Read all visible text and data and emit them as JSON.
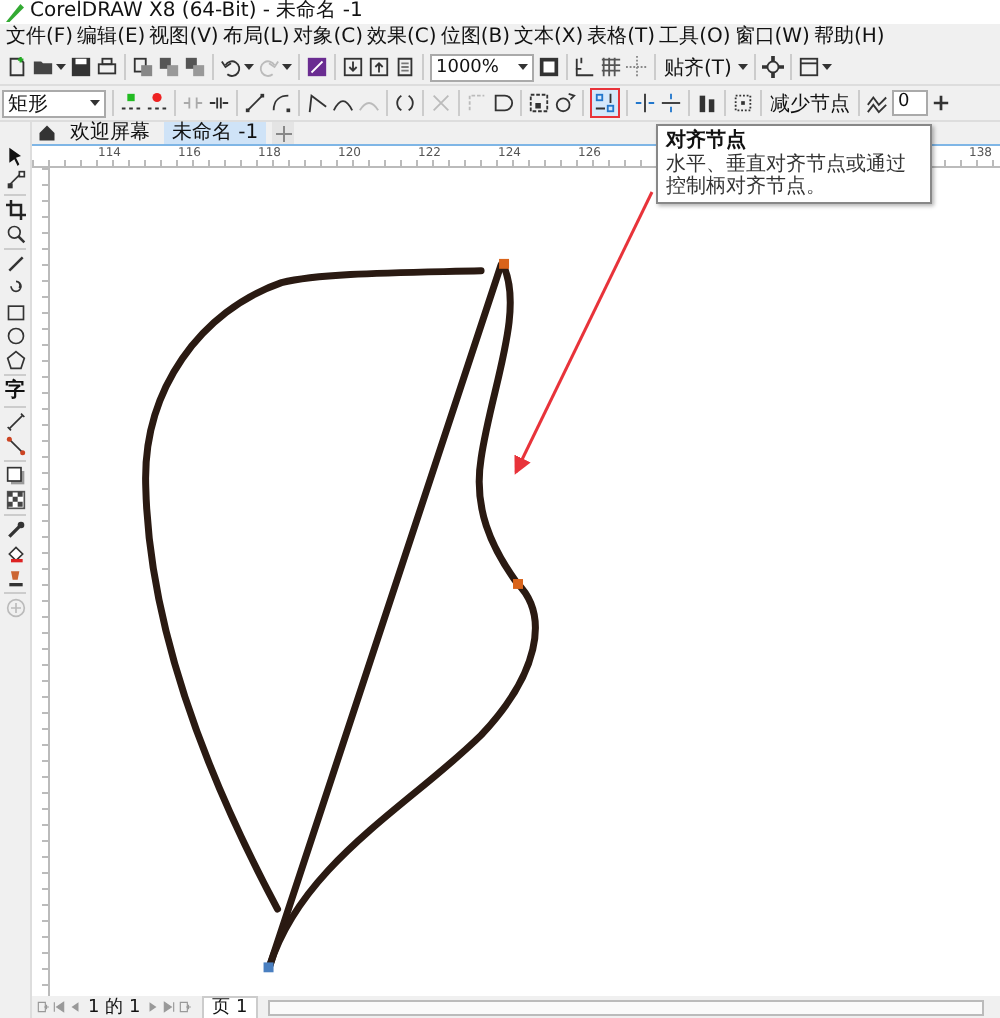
{
  "window": {
    "title": "CorelDRAW X8 (64-Bit) - 未命名 -1"
  },
  "menu": [
    "文件(F)",
    "编辑(E)",
    "视图(V)",
    "布局(L)",
    "对象(C)",
    "效果(C)",
    "位图(B)",
    "文本(X)",
    "表格(T)",
    "工具(O)",
    "窗口(W)",
    "帮助(H)"
  ],
  "toolbar": {
    "zoom": "1000%",
    "snap": "贴齐(T)"
  },
  "property_bar": {
    "shape": "矩形",
    "reduce_nodes": "减少节点",
    "smoothness": "0"
  },
  "tabs": [
    {
      "label": "欢迎屏幕",
      "selected": false
    },
    {
      "label": "未命名 -1",
      "selected": true
    }
  ],
  "toolbox": {
    "text_tool": "字"
  },
  "ruler": {
    "labels": [
      "114",
      "116",
      "118",
      "120",
      "122",
      "124",
      "126"
    ],
    "right_label": "138"
  },
  "tooltip": {
    "title": "对齐节点",
    "text": "水平、垂直对齐节点或通过控制柄对齐节点。"
  },
  "page_nav": {
    "position": "1 的 1",
    "page_tab": "页 1"
  }
}
